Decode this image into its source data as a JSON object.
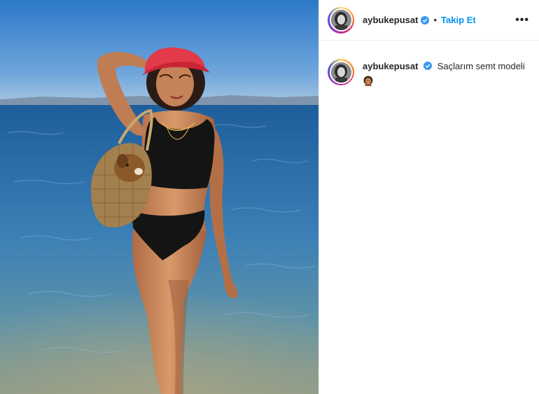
{
  "post": {
    "username": "aybukepusat",
    "follow_label": "Takip Et",
    "dot": "•",
    "more_label": "•••",
    "caption": "Saçlarım semt modeli"
  },
  "icons": {
    "verified": "verified-badge-icon",
    "more": "more-options-icon",
    "emoji": "woman-haircut-emoji"
  },
  "colors": {
    "accent_blue": "#0095f6",
    "text": "#262626",
    "divider": "#efefef"
  }
}
